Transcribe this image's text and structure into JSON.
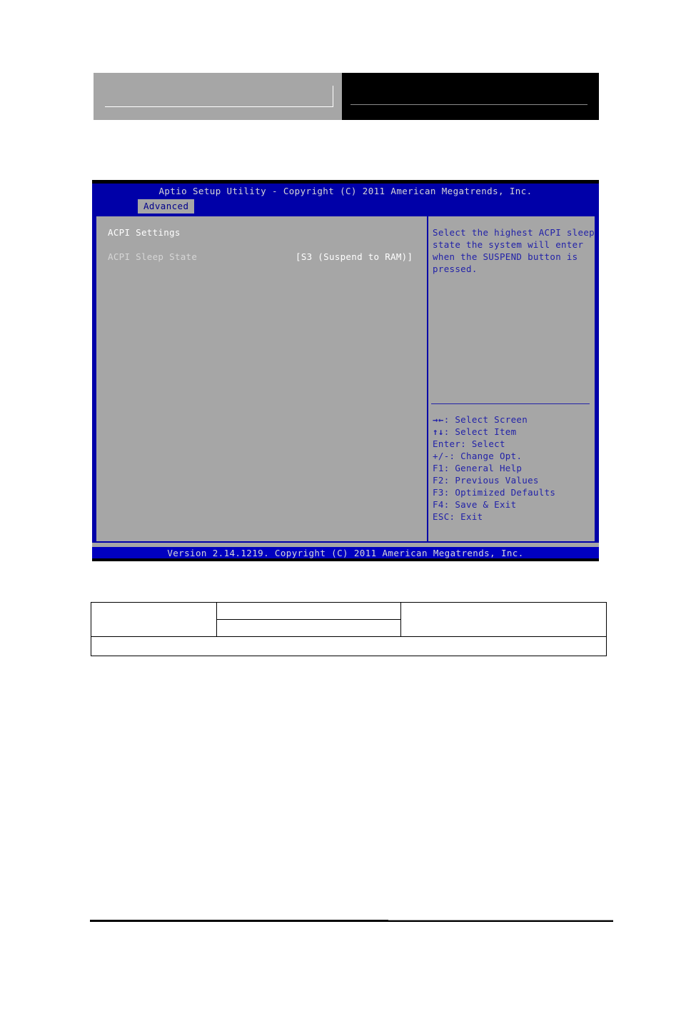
{
  "page": {
    "header": {
      "left_block_name": "logo-placeholder-block",
      "right_block_name": "title-placeholder-block"
    }
  },
  "bios": {
    "title": "Aptio Setup Utility - Copyright (C) 2011 American Megatrends, Inc.",
    "tabs": [
      {
        "label": "Advanced",
        "active": true
      }
    ],
    "left_pane": {
      "heading": "ACPI Settings",
      "settings": [
        {
          "label": "ACPI Sleep State",
          "value": "[S3 (Suspend to RAM)]"
        }
      ]
    },
    "right_pane": {
      "help_lines": [
        "Select the highest ACPI sleep",
        "state the system will enter",
        "when the SUSPEND button is",
        "pressed."
      ],
      "key_legend": [
        {
          "glyph": "→←",
          "text": ": Select Screen"
        },
        {
          "glyph": "↑↓",
          "text": ": Select Item"
        },
        {
          "glyph": "Enter",
          "text": ": Select"
        },
        {
          "glyph": "+/-",
          "text": ": Change Opt."
        },
        {
          "glyph": "F1",
          "text": ": General Help"
        },
        {
          "glyph": "F2",
          "text": ": Previous Values"
        },
        {
          "glyph": "F3",
          "text": ": Optimized Defaults"
        },
        {
          "glyph": "F4",
          "text": ": Save & Exit"
        },
        {
          "glyph": "ESC",
          "text": ": Exit"
        }
      ]
    },
    "footer": "Version 2.14.1219. Copyright (C) 2011 American Megatrends, Inc."
  },
  "lower_table": {
    "rows": [
      {
        "cells": [
          "",
          "",
          ""
        ]
      },
      {
        "cells": [
          ""
        ]
      }
    ]
  },
  "colors": {
    "bios_blue": "#0000a8",
    "bios_panel_gray": "#a6a6a6",
    "bios_help_blue": "#2222a8",
    "bios_text_white": "#ffffff",
    "bios_text_dim": "#d6d6d6"
  }
}
